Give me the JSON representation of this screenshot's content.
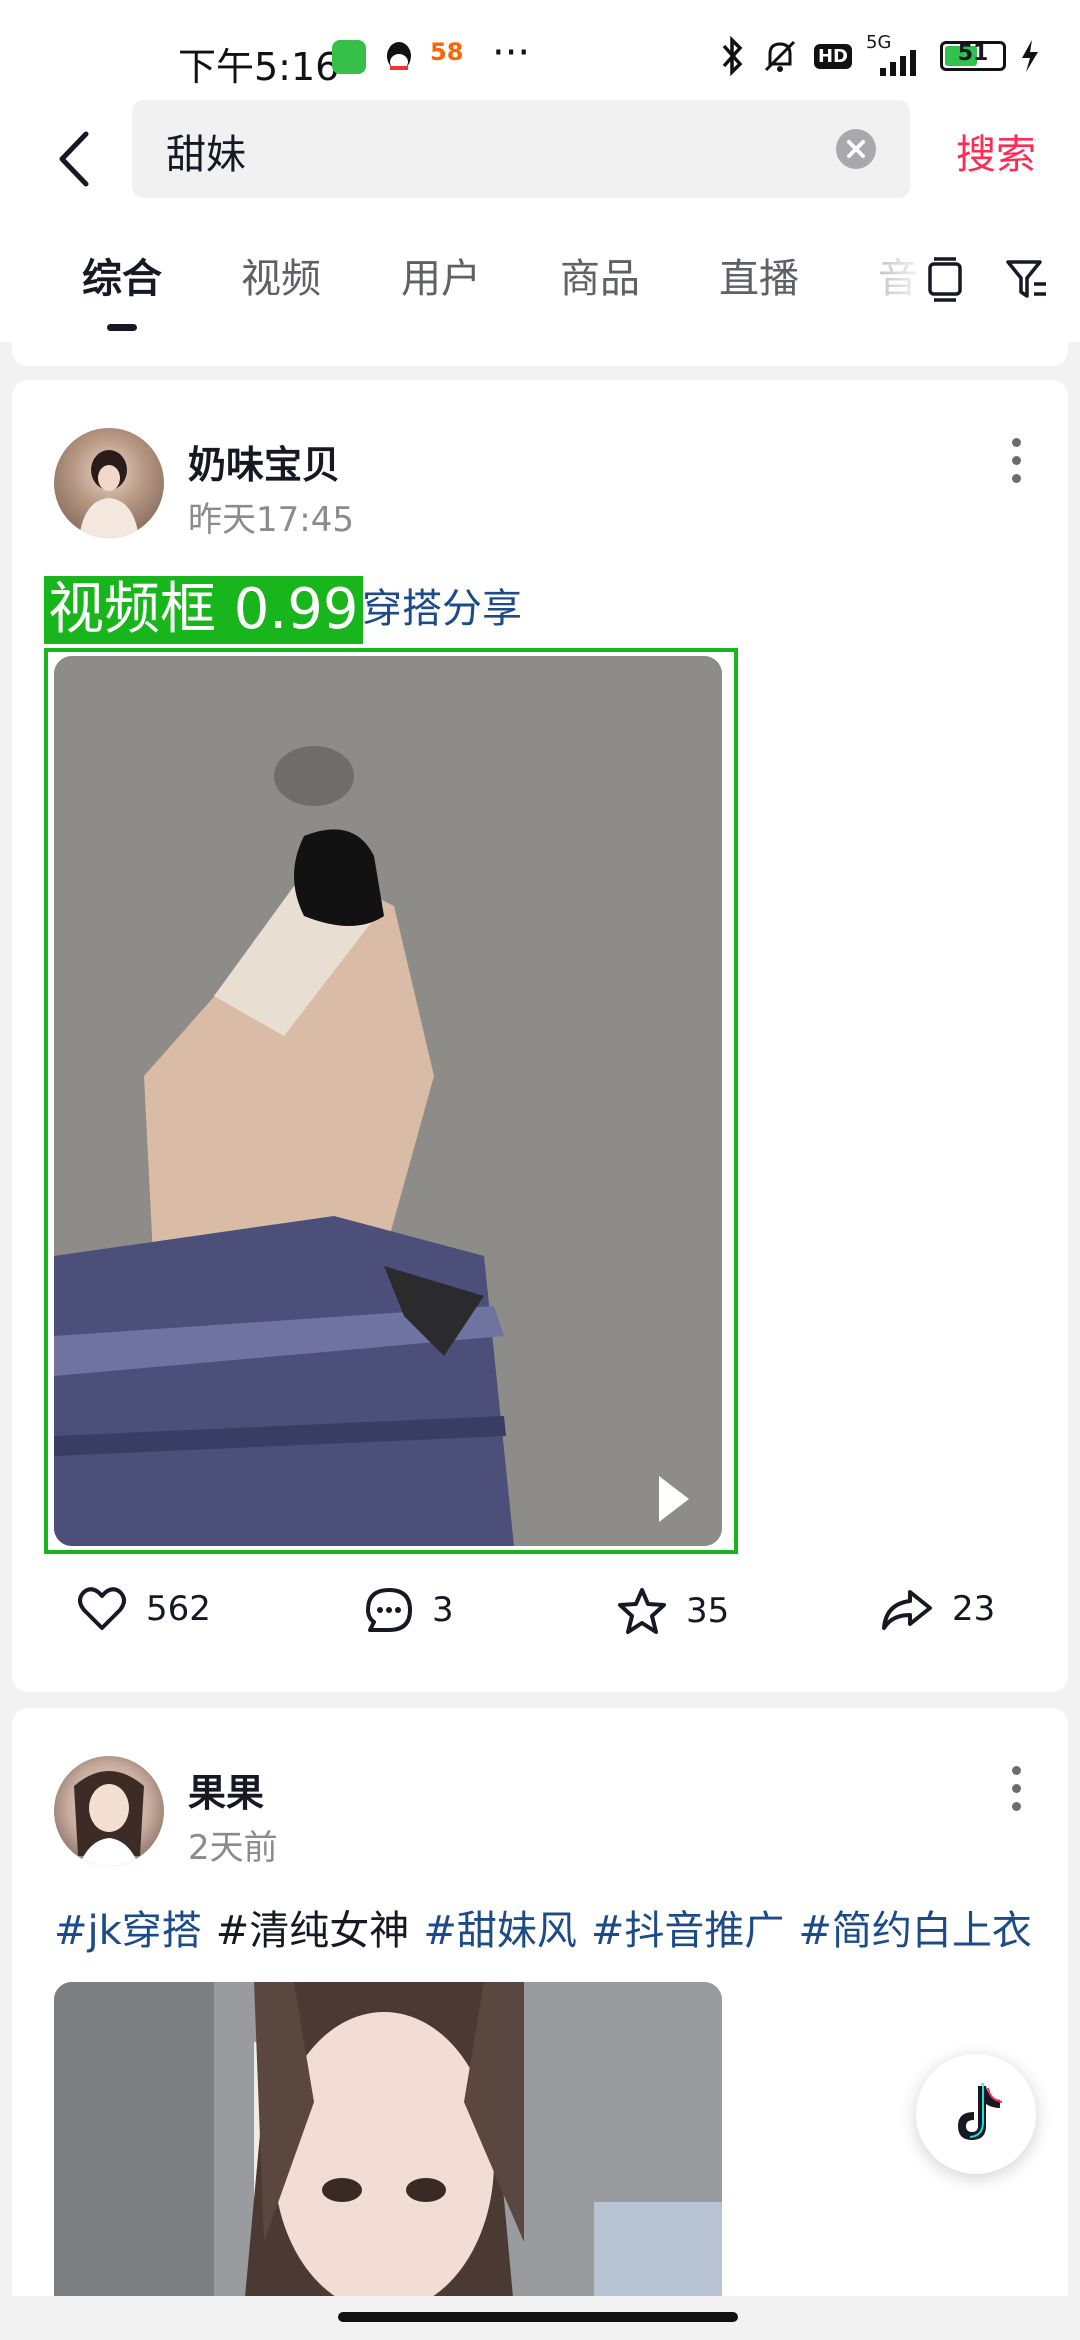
{
  "status_bar": {
    "time": "下午5:16",
    "app_icons": [
      "wechat-icon",
      "qq-icon",
      "58-icon"
    ],
    "more": "···",
    "network": "5G",
    "hd": "HD",
    "battery": "51"
  },
  "search": {
    "query": "甜妹",
    "button_label": "搜索"
  },
  "tabs": [
    {
      "label": "综合",
      "active": true
    },
    {
      "label": "视频"
    },
    {
      "label": "用户"
    },
    {
      "label": "商品"
    },
    {
      "label": "直播"
    },
    {
      "label": "音"
    }
  ],
  "posts": [
    {
      "username": "奶味宝贝",
      "time": "昨天17:45",
      "caption": "穿搭分享",
      "detection_label": "视频框 0.99",
      "stats": {
        "likes": "562",
        "comments": "3",
        "favorites": "35",
        "shares": "23"
      }
    },
    {
      "username": "果果",
      "time": "2天前",
      "hashtags": [
        "#jk穿搭",
        "#清纯女神",
        "#甜妹风",
        "#抖音推广",
        "#简约白上衣"
      ]
    }
  ],
  "colors": {
    "accent": "#fe2c55",
    "link": "#1d4b88",
    "detection_green": "#19b51c"
  }
}
